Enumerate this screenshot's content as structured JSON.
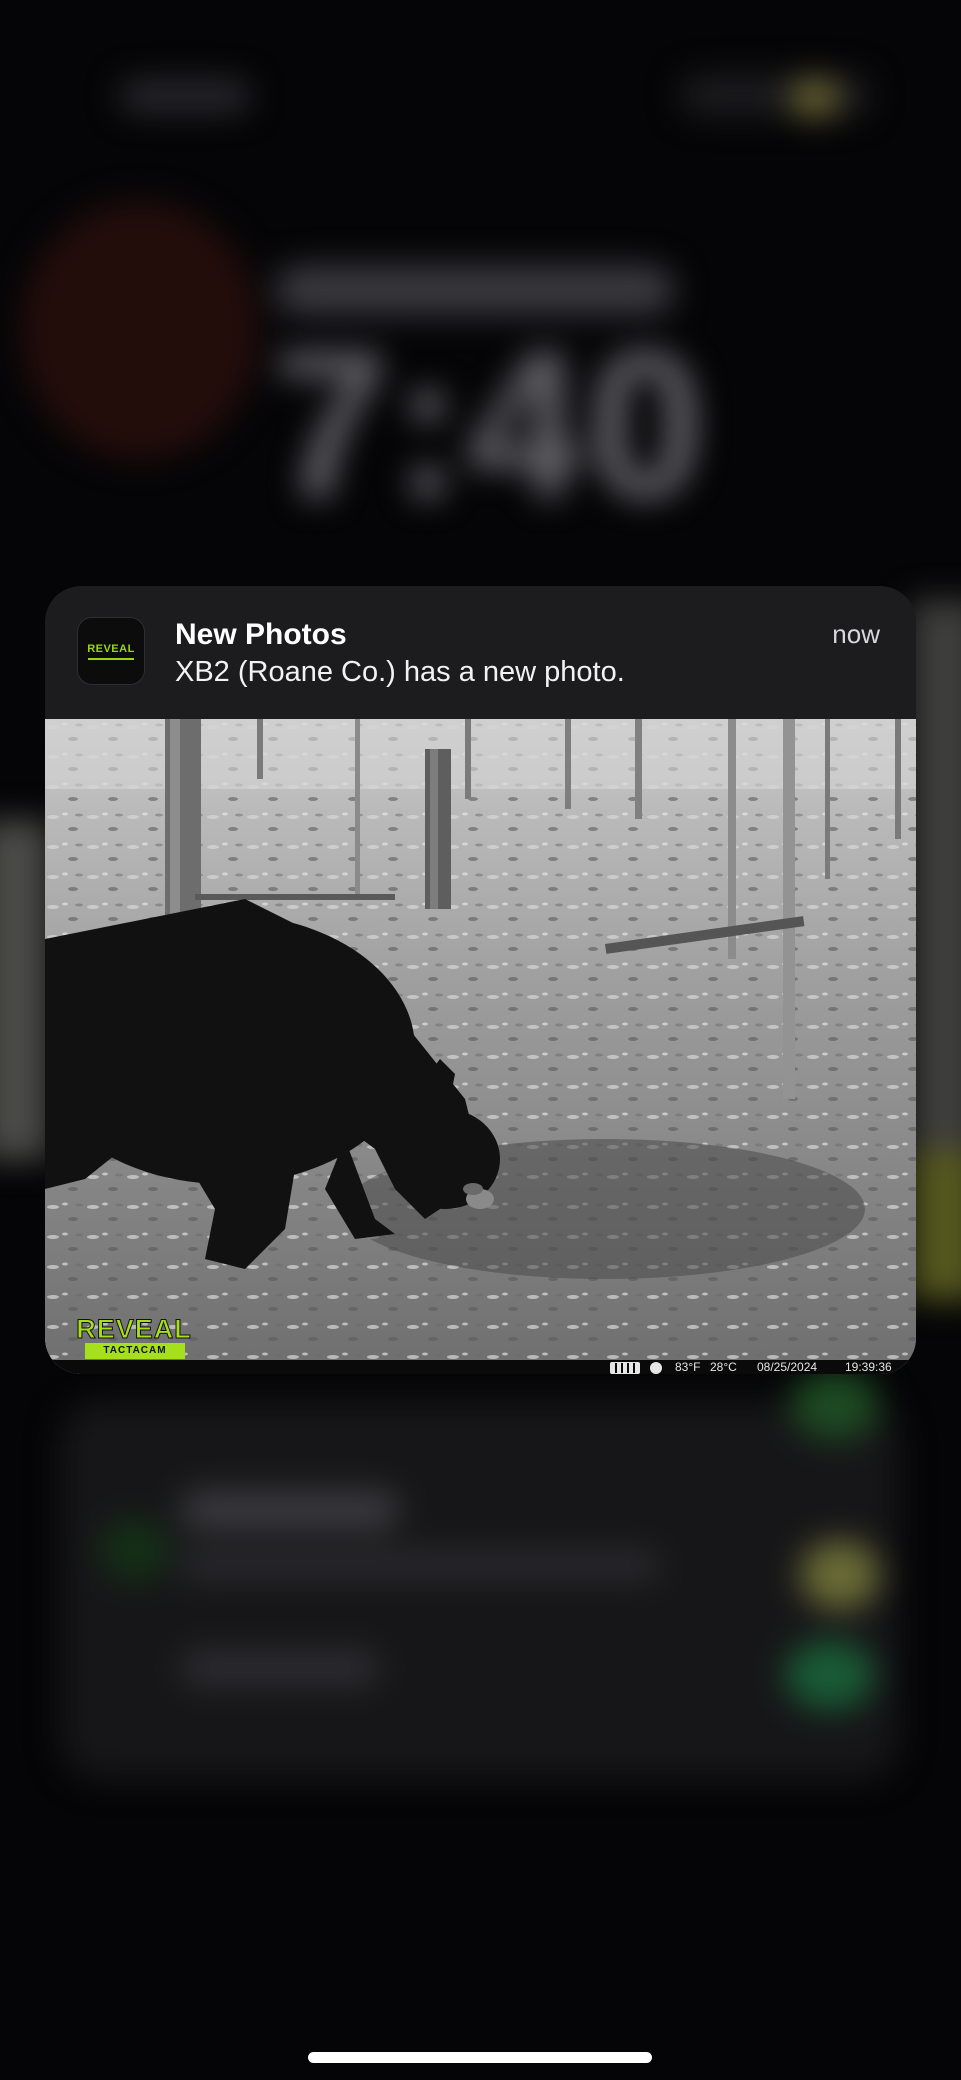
{
  "lock_screen": {
    "clock": "7:40"
  },
  "notification": {
    "app_icon": "reveal-app-icon",
    "app_icon_text": "REVEAL",
    "title": "New Photos",
    "body": "XB2 (Roane Co.) has a new photo.",
    "time": "now"
  },
  "photo": {
    "watermark_brand": "REVEAL",
    "watermark_sub": "TACTACAM",
    "info_bar": {
      "temp_f": "83°F",
      "temp_c": "28°C",
      "date": "08/25/2024",
      "time": "19:39:36",
      "battery_icon": "battery-icon",
      "moon_icon": "moon-phase-icon"
    }
  },
  "colors": {
    "notification_bg": "#1c1c1e",
    "brand_green": "#a6e01a"
  }
}
